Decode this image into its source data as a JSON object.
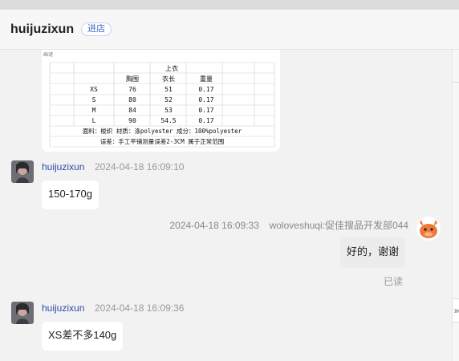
{
  "header": {
    "shop_name": "huijuzixun",
    "shop_button": "进店"
  },
  "size_chart": {
    "corner_label": "画谜",
    "title": "上衣",
    "columns": [
      "",
      "胸围",
      "衣长",
      "重量"
    ],
    "rows": [
      [
        "XS",
        "76",
        "51",
        "0.17"
      ],
      [
        "S",
        "80",
        "52",
        "0.17"
      ],
      [
        "M",
        "84",
        "53",
        "0.17"
      ],
      [
        "L",
        "90",
        "54.5",
        "0.17"
      ]
    ],
    "material_line": "面料：梭织   材质：涤polyester   成分：100%polyester",
    "error_line": "误差：手工平铺测量误差2-3CM 属于正常范围"
  },
  "messages": [
    {
      "sender": "huijuzixun",
      "time": "2024-04-18 16:09:10",
      "text": "150-170g"
    },
    {
      "sender": "woloveshuqi:促佳搜品开发部044",
      "time": "2024-04-18 16:09:33",
      "text": "好的，谢谢",
      "status": "已读"
    },
    {
      "sender": "huijuzixun",
      "time": "2024-04-18 16:09:36",
      "text": "XS差不多140g"
    }
  ],
  "sidebar": {
    "collapse_label": "»"
  }
}
